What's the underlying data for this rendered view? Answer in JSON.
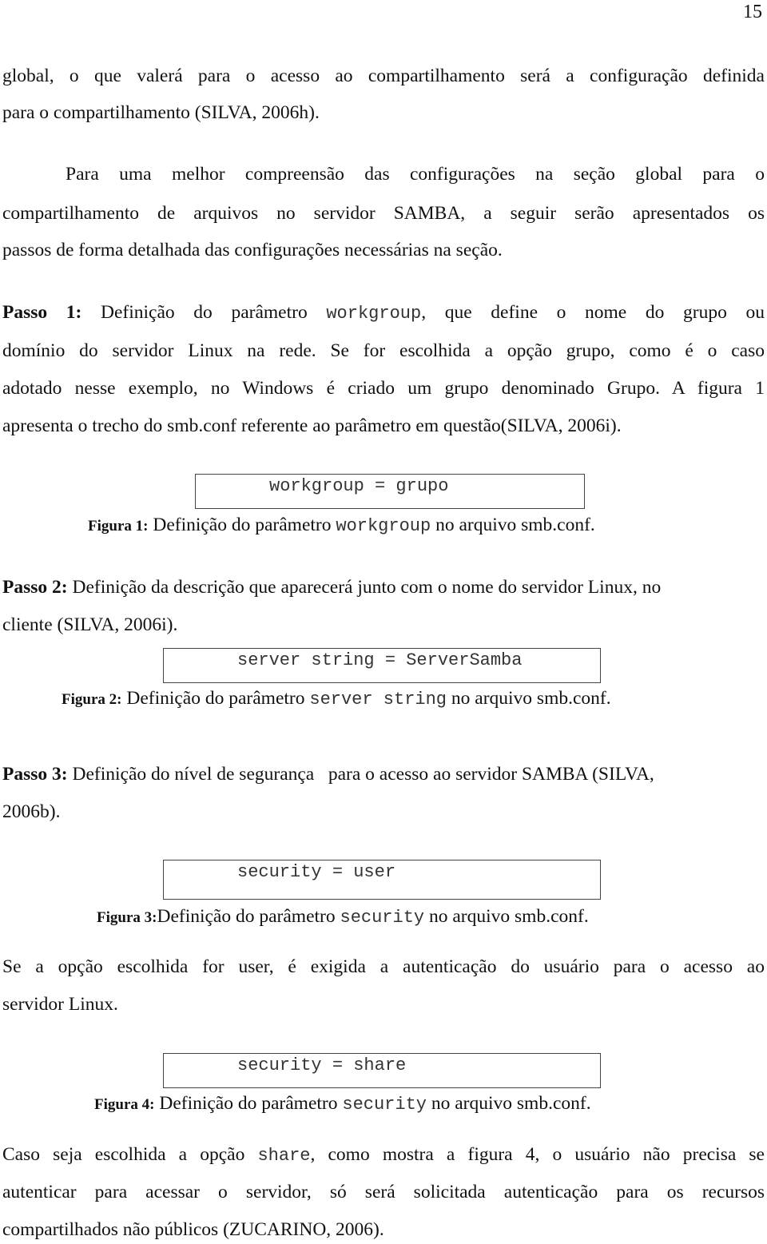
{
  "page_number": "15",
  "paragraphs": {
    "p1": {
      "line1": "global, o que valerá para o acesso ao compartilhamento será a configuração definida",
      "line2": "para o compartilhamento (SILVA, 2006h)."
    },
    "p2": {
      "line1": "Para uma melhor compreensão das configurações na seção global para o",
      "line2": "compartilhamento de arquivos no servidor SAMBA, a seguir serão apresentados os",
      "line3": "passos de forma detalhada das configurações necessárias na seção."
    },
    "step1": {
      "label": "Passo 1:",
      "line1_before": " Definição do parâmetro ",
      "line1_code": "workgroup",
      "line1_after": ", que define o nome do grupo ou",
      "line2": "domínio do servidor Linux na rede. Se for escolhida a opção grupo, como é o caso",
      "line3": "adotado nesse exemplo, no Windows é criado um grupo denominado Grupo. A figura 1",
      "line4": "apresenta o trecho do smb.conf referente ao parâmetro em questão(SILVA, 2006i)."
    },
    "figure1": {
      "code": "workgroup = grupo",
      "caption_label": "Figura 1:",
      "caption_before": " Definição do parâmetro ",
      "caption_code": "workgroup",
      "caption_after": " no arquivo smb.conf."
    },
    "step2": {
      "label": "Passo 2:",
      "line1": " Definição da descrição que aparecerá junto com o nome do servidor Linux, no",
      "line2": "cliente (SILVA, 2006i)."
    },
    "figure2": {
      "code": "server string = ServerSamba",
      "caption_label": "Figura 2:",
      "caption_before": " Definição do parâmetro ",
      "caption_code": "server string",
      "caption_after": " no arquivo smb.conf."
    },
    "step3": {
      "label": "Passo 3:",
      "line1": " Definição do nível de segurança   para o acesso ao servidor SAMBA (SILVA,",
      "line2": "2006b)."
    },
    "figure3": {
      "code": "security = user",
      "caption_label": "Figura 3:",
      "caption_before": "Definição do parâmetro ",
      "caption_code": "security",
      "caption_after": " no arquivo smb.conf."
    },
    "p_user": {
      "line1": "Se a opção escolhida for user, é exigida a autenticação do usuário para o acesso ao",
      "line2": "servidor Linux."
    },
    "figure4": {
      "code": "security = share",
      "caption_label": "Figura 4:",
      "caption_before": " Definição do parâmetro ",
      "caption_code": "security",
      "caption_after": " no arquivo smb.conf."
    },
    "p_share": {
      "line1_before": "Caso seja escolhida a opção ",
      "line1_code": "share",
      "line1_after": ", como mostra a figura 4, o usuário não precisa se",
      "line2": "autenticar para acessar o servidor, só será solicitada autenticação para os recursos",
      "line3": "compartilhados não públicos (ZUCARINO, 2006)."
    }
  }
}
